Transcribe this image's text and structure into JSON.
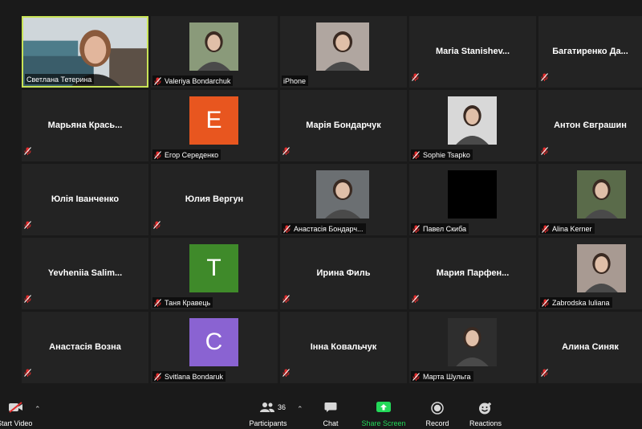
{
  "participants": [
    {
      "name": "Светлана Тетерина",
      "type": "video",
      "active": true,
      "muted": false
    },
    {
      "name": "Valeriya Bondarchuk",
      "type": "photo",
      "muted": true,
      "photo_color": "#8a9a7a"
    },
    {
      "name": "iPhone",
      "type": "photo",
      "muted": false,
      "photo_color": "#b0a6a0"
    },
    {
      "name": "Maria  Stanishev...",
      "type": "name",
      "muted": true
    },
    {
      "name": "Багатиренко  Да...",
      "type": "name",
      "muted": true
    },
    {
      "name": "Марьяна  Крась...",
      "type": "name",
      "muted": true
    },
    {
      "name": "Егор Середенко",
      "type": "avatar",
      "letter": "E",
      "avatar_color": "#e8561f",
      "muted": true
    },
    {
      "name": "Марія Бондарчук",
      "type": "name",
      "muted": true
    },
    {
      "name": "Sophie Tsapko",
      "type": "photo",
      "muted": true,
      "photo_color": "#d8d8d8"
    },
    {
      "name": "Антон Євграшин",
      "type": "name",
      "muted": true
    },
    {
      "name": "Юлія Іванченко",
      "type": "name",
      "muted": true
    },
    {
      "name": "Юлия Вергун",
      "type": "name",
      "muted": true
    },
    {
      "name": "Анастасія Бондарч...",
      "type": "photo",
      "muted": true,
      "photo_color": "#6b6f72"
    },
    {
      "name": "Павел Скиба",
      "type": "photo",
      "muted": true,
      "photo_color": "#000000"
    },
    {
      "name": "Alina Kerner",
      "type": "photo",
      "muted": true,
      "photo_color": "#5a6b4a"
    },
    {
      "name": "Yevheniia  Salim...",
      "type": "name",
      "muted": true
    },
    {
      "name": "Таня Кравець",
      "type": "avatar",
      "letter": "T",
      "avatar_color": "#3f8a2a",
      "muted": true
    },
    {
      "name": "Ирина Филь",
      "type": "name",
      "muted": true
    },
    {
      "name": "Мария  Парфен...",
      "type": "name",
      "muted": true
    },
    {
      "name": "Zabrodska Iuliana",
      "type": "photo",
      "muted": true,
      "photo_color": "#a89a92"
    },
    {
      "name": "Анастасія Возна",
      "type": "name",
      "muted": true
    },
    {
      "name": "Svitlana Bondaruk",
      "type": "avatar",
      "letter": "C",
      "avatar_color": "#8a63d2",
      "muted": true
    },
    {
      "name": "Інна Ковальчук",
      "type": "name",
      "muted": true
    },
    {
      "name": "Марта Шульга",
      "type": "photo",
      "muted": true,
      "photo_color": "#2e2e2e"
    },
    {
      "name": "Алина Синяк",
      "type": "name",
      "muted": true
    }
  ],
  "toolbar": {
    "start_video": "Start Video",
    "participants": "Participants",
    "participant_count": "36",
    "chat": "Chat",
    "share_screen": "Share Screen",
    "record": "Record",
    "reactions": "Reactions"
  },
  "colors": {
    "active_speaker_border": "#c8e356",
    "share_screen_green": "#23d959",
    "mute_red": "#e02b2b"
  }
}
